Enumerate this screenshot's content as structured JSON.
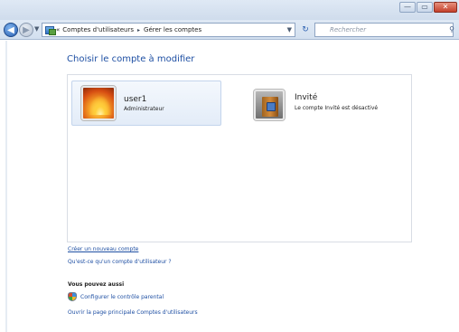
{
  "window": {
    "controls": {
      "minimize": "—",
      "maximize": "▭",
      "close": "✕"
    }
  },
  "navigation": {
    "breadcrumb": {
      "prefix": "«",
      "items": [
        "Comptes d'utilisateurs",
        "Gérer les comptes"
      ],
      "separator": "▸"
    },
    "search_placeholder": "Rechercher"
  },
  "main": {
    "heading": "Choisir le compte à modifier",
    "accounts": [
      {
        "name": "user1",
        "subtitle": "Administrateur"
      },
      {
        "name": "Invité",
        "subtitle": "Le compte Invité est désactivé"
      }
    ],
    "links": {
      "create_account": "Créer un nouveau compte",
      "what_is_account": "Qu'est-ce qu'un compte d'utilisateur ?"
    },
    "see_also": {
      "title": "Vous pouvez aussi",
      "parental_controls": "Configurer le contrôle parental",
      "main_page": "Ouvrir la page principale Comptes d'utilisateurs"
    }
  },
  "colors": {
    "link": "#1e4fa3",
    "heading": "#1e4fa3",
    "selection": "#e3ecf8"
  },
  "icons": {
    "back": "back-arrow-icon",
    "forward": "forward-arrow-icon",
    "address": "control-panel-icon",
    "refresh": "refresh-icon",
    "search": "search-icon",
    "parental": "parental-shield-icon"
  }
}
